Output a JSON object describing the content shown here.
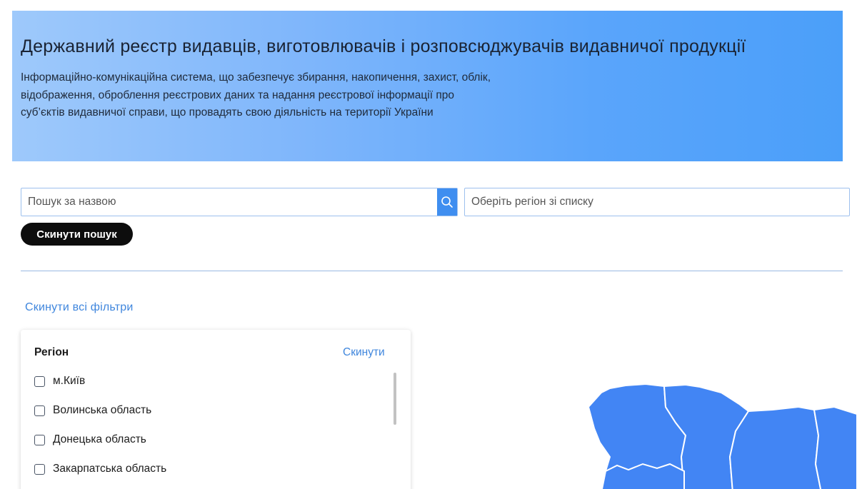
{
  "hero": {
    "title": "Державний реєстр видавців, виготовлювачів і розповсюджувачів видавничої продукції",
    "description": "Інформаційно-комунікаційна система, що забезпечує збирання, накопичення, захист, облік, відображення, оброблення реєстрових даних та надання реєстрової інформації про суб’єктів видавничої справи, що провадять свою діяльність на території України"
  },
  "search": {
    "placeholder": "Пошук за назвою",
    "button_icon": "search-icon"
  },
  "region_select": {
    "placeholder": "Оберіть регіон зі списку"
  },
  "reset_search_label": "Скинути пошук",
  "reset_all_filters_label": "Скинути всі фільтри",
  "filter": {
    "title": "Регіон",
    "reset_label": "Скинути",
    "regions": [
      {
        "label": "м.Київ",
        "checked": false
      },
      {
        "label": "Волинська область",
        "checked": false
      },
      {
        "label": "Донецька область",
        "checked": false
      },
      {
        "label": "Закарпатська область",
        "checked": false
      }
    ]
  },
  "colors": {
    "accent": "#3f8ef0",
    "link": "#3f86dd",
    "map_fill": "#4285f4",
    "hero_gradient_start": "#9ec9fb",
    "hero_gradient_end": "#4b9ff9"
  },
  "map": {
    "icon": "ukraine-regions-map"
  }
}
